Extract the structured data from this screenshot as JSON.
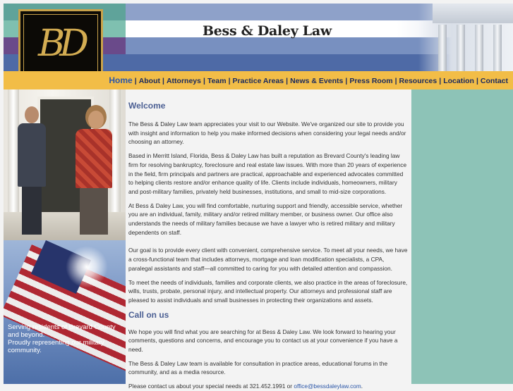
{
  "header": {
    "logo_text": "BD",
    "site_title": "Bess & Daley Law"
  },
  "nav": {
    "items": [
      "Home",
      "About",
      "Attorneys",
      "Team",
      "Practice Areas",
      "News & Events",
      "Press Room",
      "Resources",
      "Location",
      "Contact"
    ]
  },
  "sidebar": {
    "caption_line1": "Serving residents of Brevard County and beyond.",
    "caption_line2": "Proudly representing our military community."
  },
  "content": {
    "welcome_heading": "Welcome",
    "p1": "The Bess & Daley Law team appreciates your visit to our Website. We've organized our site to provide you with insight and information to help you make informed decisions when considering your legal needs and/or choosing an attorney.",
    "p2": "Based in Merritt Island, Florida, Bess & Daley Law has built a reputation as Brevard County's leading law firm for resolving bankruptcy, foreclosure and real estate law issues. With more than 20 years of experience in the field, firm principals and partners are practical, approachable and experienced advocates committed to helping clients restore and/or enhance quality of life. Clients include individuals, homeowners, military and post-military families, privately held businesses, institutions, and small to mid-size corporations.",
    "p3": "At Bess & Daley Law, you will find comfortable, nurturing support and friendly, accessible service, whether you are an individual, family, military and/or retired military member, or business owner. Our office also understands the needs of military families because we have a lawyer who is retired military and military dependents on staff.",
    "p4": "Our goal is to provide every client with convenient, comprehensive service. To meet all your needs, we have a cross-functional team that includes attorneys, mortgage and loan modification specialists, a CPA, paralegal assistants and staff—all committed to caring for you with detailed attention and compassion.",
    "p5": "To meet the needs of individuals, families and corporate clients, we also practice in the areas of foreclosure, wills, trusts, probate, personal injury, and intellectual property. Our attorneys and professional staff are pleased to assist individuals and small businesses in protecting their organizations and assets.",
    "callus_heading": "Call on us",
    "p6": "We hope you will find what you are searching for at Bess & Daley Law. We look forward to hearing your comments, questions and concerns, and encourage you to contact us at your convenience if you have a need.",
    "p7": "The Bess & Daley Law team is available for consultation in practice areas, educational forums in the community, and as a media resource.",
    "p8_prefix": "Please contact us about your special needs at 321.452.1991 or ",
    "email": "office@bessdaleylaw.com",
    "p8_suffix": "."
  },
  "colors": {
    "nav_bg": "#f2bd47",
    "header_blue": "#4e6aa6",
    "right_teal": "#8dc3b7",
    "heading": "#4b5f93",
    "logo_gold": "#d4ad52"
  }
}
